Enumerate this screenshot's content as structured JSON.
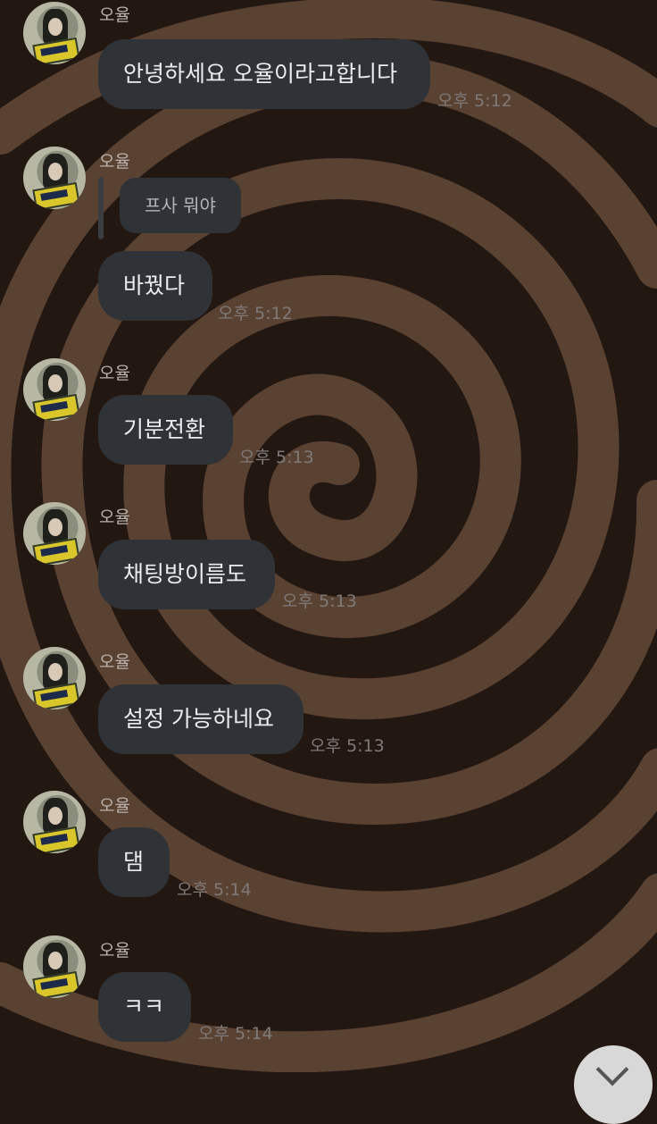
{
  "chat": {
    "messages": [
      {
        "sender": "오율",
        "text": "안녕하세요 오율이라고합니다",
        "time": "오후 5:12"
      },
      {
        "sender": "오율",
        "reply_quote": "프사 뭐야",
        "text": "바꿨다",
        "time": "오후 5:12"
      },
      {
        "sender": "오율",
        "text": "기분전환",
        "time": "오후 5:13"
      },
      {
        "sender": "오율",
        "text": "채팅방이름도",
        "time": "오후 5:13"
      },
      {
        "sender": "오율",
        "text": "설정 가능하네요",
        "time": "오후 5:13"
      },
      {
        "sender": "오율",
        "text": "댐",
        "time": "오후 5:14"
      },
      {
        "sender": "오율",
        "text": "ㅋㅋ",
        "time": "오후 5:14"
      }
    ]
  },
  "icons": {
    "scroll_down": "chevron-down-icon"
  },
  "colors": {
    "background": "#231712",
    "swirl": "#5a4233",
    "bubble": "#2f3236",
    "bubble_text": "#ececee",
    "time_text": "#7e7a79"
  }
}
